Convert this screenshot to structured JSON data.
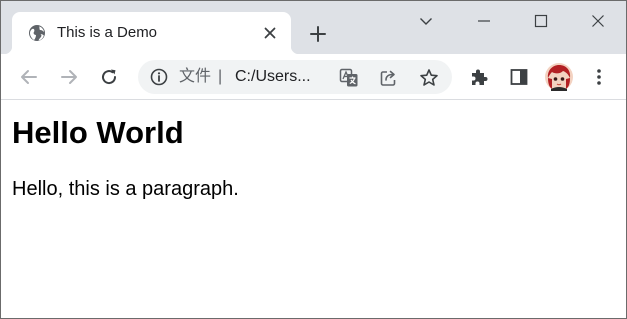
{
  "tab": {
    "title": "This is a Demo",
    "favicon": "globe-icon"
  },
  "address_bar": {
    "scheme_label": "文件",
    "separator": "|",
    "url": "C:/Users..."
  },
  "page": {
    "heading": "Hello World",
    "paragraph": "Hello, this is a paragraph."
  },
  "colors": {
    "tabstrip_bg": "#dee1e6",
    "omnibox_bg": "#f1f3f4",
    "icon_gray": "#5f6368",
    "icon_dark": "#3c4043"
  }
}
